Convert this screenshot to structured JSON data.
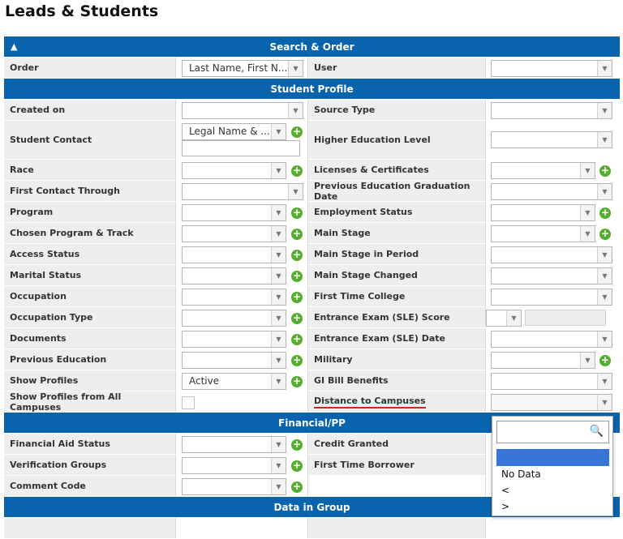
{
  "page_title": "Leads & Students",
  "sections": {
    "search_order": "Search & Order",
    "student_profile": "Student Profile",
    "financial": "Financial/PP",
    "data_in_group": "Data in Group"
  },
  "rows": {
    "order": {
      "l": "Order",
      "val": "Last Name, First N...",
      "r": "User"
    },
    "created_on": {
      "l": "Created on",
      "r": "Source Type"
    },
    "student_contact": {
      "l": "Student Contact",
      "val": "Legal Name & ...",
      "r": "Higher Education Level"
    },
    "race": {
      "l": "Race",
      "r": "Licenses & Certificates"
    },
    "first_contact": {
      "l": "First Contact Through",
      "r": "Previous Education Graduation Date"
    },
    "program": {
      "l": "Program",
      "r": "Employment Status"
    },
    "chosen_program": {
      "l": "Chosen Program & Track",
      "r": "Main Stage"
    },
    "access_status": {
      "l": "Access Status",
      "r": "Main Stage in Period"
    },
    "marital_status": {
      "l": "Marital Status",
      "r": "Main Stage Changed"
    },
    "occupation": {
      "l": "Occupation",
      "r": "First Time College"
    },
    "occupation_type": {
      "l": "Occupation Type",
      "r": "Entrance Exam (SLE) Score"
    },
    "documents": {
      "l": "Documents",
      "r": "Entrance Exam (SLE) Date"
    },
    "previous_education": {
      "l": "Previous Education",
      "r": "Military"
    },
    "show_profiles": {
      "l": "Show Profiles",
      "val": "Active",
      "r": "GI Bill Benefits"
    },
    "show_all_campuses": {
      "l": "Show Profiles from All Campuses",
      "r": "Distance to Campuses"
    },
    "financial_aid": {
      "l": "Financial Aid Status",
      "r": "Credit Granted"
    },
    "verification": {
      "l": "Verification Groups",
      "r": "First Time Borrower"
    },
    "comment_code": {
      "l": "Comment Code"
    }
  },
  "dropdown": {
    "options": [
      "No Data",
      "<",
      ">"
    ]
  },
  "icons": {
    "collapse": "chevron-up-icon",
    "add": "plus-circle-icon",
    "search": "magnifier-icon"
  },
  "colors": {
    "header": "#0a64ad",
    "add": "#55ad2e",
    "highlight": "#3875d7",
    "underline": "#e02020"
  }
}
